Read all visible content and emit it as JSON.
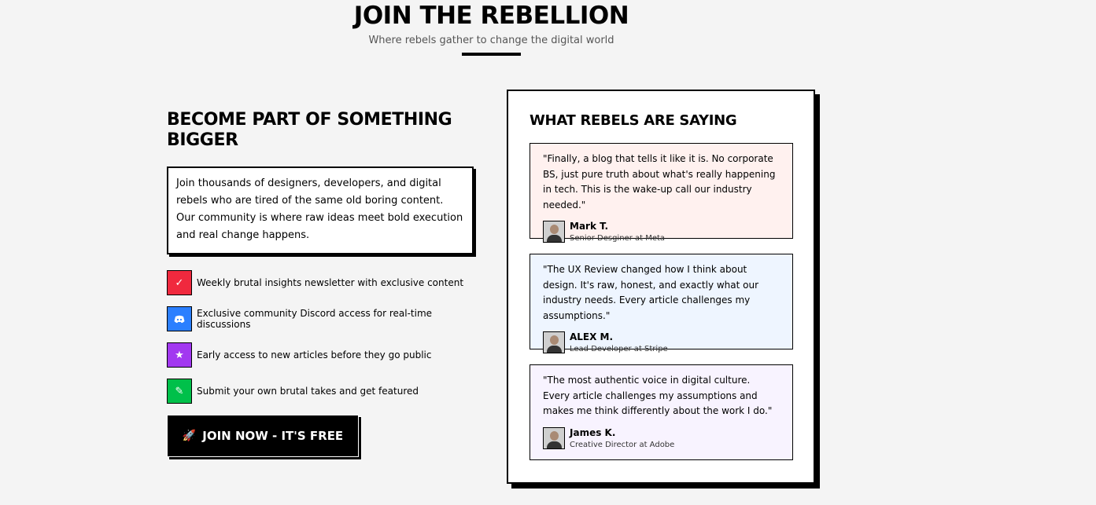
{
  "header": {
    "title": "JOIN THE REBELLION",
    "subtitle": "Where rebels gather to change the digital world"
  },
  "left": {
    "heading": "BECOME PART OF SOMETHING BIGGER",
    "intro": "Join thousands of designers, developers, and digital rebels who are tired of the same old boring content. Our community is where raw ideas meet bold execution and real change happens.",
    "features": [
      {
        "icon": "check-icon",
        "color": "#f0293e",
        "text": "Weekly brutal insights newsletter with exclusive content"
      },
      {
        "icon": "discord-icon",
        "color": "#2b7fff",
        "text": "Exclusive community Discord access for real-time discussions"
      },
      {
        "icon": "star-icon",
        "color": "#a238f0",
        "text": "Early access to new articles before they go public"
      },
      {
        "icon": "pencil-icon",
        "color": "#00c04a",
        "text": "Submit your own brutal takes and get featured"
      }
    ],
    "join_button": "JOIN NOW - IT'S FREE"
  },
  "testimonials": {
    "heading": "WHAT REBELS ARE SAYING",
    "items": [
      {
        "quote": "\"Finally, a blog that tells it like it is. No corporate BS, just pure truth about what's really happening in tech. This is the wake-up call our industry needed.\"",
        "name": "Mark T.",
        "role": "Senior Desginer at Meta",
        "bg": "#fff1ef"
      },
      {
        "quote": "\"The UX Review changed how I think about design. It's raw, honest, and exactly what our industry needs. Every article challenges my assumptions.\"",
        "name": "ALEX M.",
        "role": "Lead Developer at Stripe",
        "bg": "#eef5ff"
      },
      {
        "quote": "\"The most authentic voice in digital culture. Every article challenges my assumptions and makes me think differently about the work I do.\"",
        "name": "James K.",
        "role": "Creative Director at Adobe",
        "bg": "#f8f3ff"
      }
    ]
  }
}
